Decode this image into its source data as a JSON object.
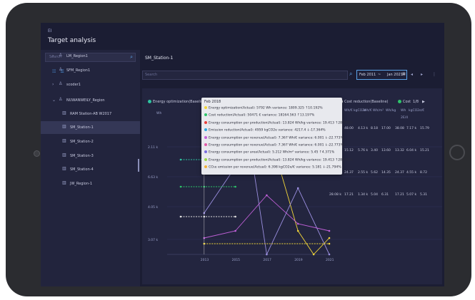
{
  "app": {
    "icon_text": "EI",
    "page_title": "Target analysis"
  },
  "sidebar": {
    "search_placeholder": "Search",
    "tree": [
      {
        "label": "LM_Region1",
        "expanded": false,
        "level": 0,
        "has_chevron": true
      },
      {
        "label": "SFM_Region1",
        "expanded": false,
        "level": 0,
        "has_chevron": false
      },
      {
        "label": "scoder1",
        "expanded": false,
        "level": 0,
        "has_chevron": true
      },
      {
        "label": "NUWANWEILY_Region",
        "expanded": true,
        "level": 0,
        "has_chevron": true
      },
      {
        "label": "RAM Station-AB W2017",
        "level": 1
      },
      {
        "label": "SM_Station-1",
        "level": 1,
        "selected": true
      },
      {
        "label": "SM_Station-2",
        "level": 1
      },
      {
        "label": "SM_Station-3",
        "level": 1
      },
      {
        "label": "SM_Station-4",
        "level": 1
      },
      {
        "label": "JW_Region-1",
        "level": 1
      }
    ]
  },
  "main": {
    "station_title": "SM_Station-1",
    "search_placeholder": "Search",
    "date_from": "Feb 2011",
    "date_sep": "~",
    "date_to": "Jan 2021"
  },
  "legend": [
    {
      "label": "Energy optimization(Baseline)",
      "color": "#2ec4a0"
    },
    {
      "label": "Energy optimization(Actual)",
      "color": "#f2d63a"
    },
    {
      "label": "Energy optimization(Target)",
      "color": "#9b8fe0"
    },
    {
      "label": "Cost reduction(Baseline)",
      "color": "#e0e0e0"
    },
    {
      "label": "Cost",
      "color": "#2ec46a"
    },
    {
      "label": "1/8",
      "color": ""
    }
  ],
  "tooltip": {
    "title": "Feb 2018",
    "rows": [
      {
        "text": "Energy optimization(Actual): 5792 Wh variance: 1809.325 ↑10.192%",
        "color": "#f2d63a"
      },
      {
        "text": "Cost reduction(Actual): 50471 € variance: 18164.563 ↑13.197%",
        "color": "#2ec46a"
      },
      {
        "text": "Energy consumption per production(Actual): 13.824 Wh/kg variance: 19.413 ↑28.791%",
        "color": "#e8403c"
      },
      {
        "text": "Emission reduction(Actual): 4959 kgCO2e variance: 4217.4 ↓-17.364%",
        "color": "#2ea8e0"
      },
      {
        "text": "Energy consumption per revenue(Actual): 7.367 Wh/€ variance: 6.001 ↓-22.773%",
        "color": "#c060d8"
      },
      {
        "text": "Energy consumption per revenue(Actual): 7.367 Wh/€ variance: 6.001 ↓-22.773%",
        "color": "#e05aa8"
      },
      {
        "text": "Energy consumption per area(Actual): 5.212 Wh/m² variance: 5.45 ↑4.371%",
        "color": "#7a6ee0"
      },
      {
        "text": "Energy consumption per production(Actual): 13.824 Wh/kg variance: 19.413 ↑28.791%",
        "color": "#9ad84a"
      },
      {
        "text": "CO₂e emission per revenue(Actual): 6.398 kgCO2e/€ variance: 5.181 ↓-21.794%",
        "color": "#f2b23a"
      }
    ]
  },
  "table": {
    "headers": [
      "Wh/€",
      "kgCO2e",
      "Wh/€",
      "Wh/m²",
      "Wh/kg",
      "Wh",
      "kgCO2e/€"
    ],
    "header_sub": "2E/4",
    "rows": [
      [
        "48.00",
        "4.13 k",
        "8.18",
        "17.00",
        "38.08",
        "7.17 k",
        "15.79"
      ],
      [
        "15.12",
        "5.76 k",
        "3.40",
        "13.60",
        "13.32",
        "6.04 k",
        "15.21"
      ],
      [
        "35.17 k",
        "24.37",
        "2.55 k",
        "5.62",
        "14.35",
        "24.37",
        "4.55 k",
        "8.72"
      ],
      [
        "28.08 k",
        "17.21",
        "1.34 k",
        "5.04",
        "6.31",
        "17.21",
        "5.07 k",
        "5.31"
      ]
    ]
  },
  "chart_data": {
    "type": "line",
    "x": [
      2011,
      2013,
      2015,
      2017,
      2019,
      2021
    ],
    "x_tick_labels": [
      "2013",
      "2015",
      "2017",
      "2019",
      "2021"
    ],
    "y_tick_labels": [
      "2.11 k",
      "6.63 k",
      "4.05 k",
      "3.07 k"
    ],
    "y_unit_label": "Wh",
    "colors": [
      "#f2d63a",
      "#9b8fe0",
      "#2ec4a0",
      "#2ec46a",
      "#e0e0e0",
      "#e05aa8",
      "#c060d8"
    ],
    "grid": true
  },
  "colors": {
    "accent": "#5ba3e8",
    "teal": "#3ec1d3"
  }
}
